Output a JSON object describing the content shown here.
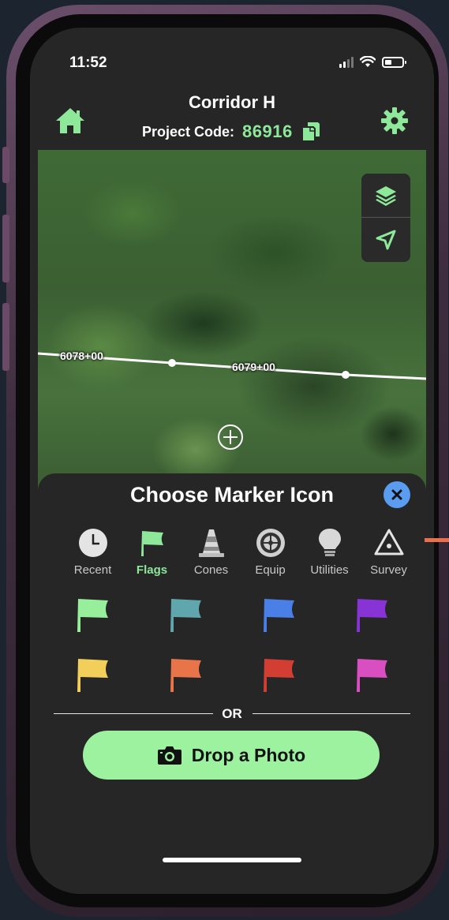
{
  "status_bar": {
    "time": "11:52"
  },
  "header": {
    "project_name": "Corridor H",
    "code_label": "Project Code:",
    "code_value": "86916",
    "accent_color": "#8ee89a"
  },
  "map": {
    "stations": [
      "6078+00",
      "6079+00"
    ],
    "controls": [
      "layers-icon",
      "location-arrow-icon"
    ]
  },
  "sheet": {
    "title": "Choose Marker Icon",
    "tabs": [
      {
        "label": "Recent",
        "icon": "clock-icon",
        "active": false
      },
      {
        "label": "Flags",
        "icon": "flag-icon",
        "active": true
      },
      {
        "label": "Cones",
        "icon": "traffic-cone-icon",
        "active": false
      },
      {
        "label": "Equip",
        "icon": "tire-icon",
        "active": false
      },
      {
        "label": "Utilities",
        "icon": "lightbulb-icon",
        "active": false
      },
      {
        "label": "Survey",
        "icon": "warning-triangle-icon",
        "active": false
      }
    ],
    "flag_colors": [
      "#97ee9b",
      "#5fa7ad",
      "#4a7fe8",
      "#8833d6",
      "#f1cf5a",
      "#e8744a",
      "#d33e32",
      "#d94fc2"
    ],
    "or_text": "OR",
    "photo_button_label": "Drop a Photo"
  }
}
